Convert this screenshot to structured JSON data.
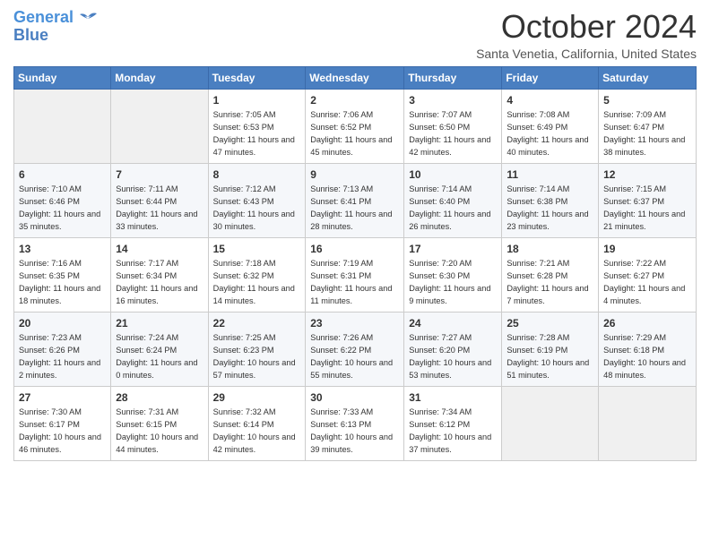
{
  "header": {
    "logo_line1": "General",
    "logo_line2": "Blue",
    "month": "October 2024",
    "location": "Santa Venetia, California, United States"
  },
  "weekdays": [
    "Sunday",
    "Monday",
    "Tuesday",
    "Wednesday",
    "Thursday",
    "Friday",
    "Saturday"
  ],
  "weeks": [
    [
      {
        "day": "",
        "sunrise": "",
        "sunset": "",
        "daylight": ""
      },
      {
        "day": "",
        "sunrise": "",
        "sunset": "",
        "daylight": ""
      },
      {
        "day": "1",
        "sunrise": "Sunrise: 7:05 AM",
        "sunset": "Sunset: 6:53 PM",
        "daylight": "Daylight: 11 hours and 47 minutes."
      },
      {
        "day": "2",
        "sunrise": "Sunrise: 7:06 AM",
        "sunset": "Sunset: 6:52 PM",
        "daylight": "Daylight: 11 hours and 45 minutes."
      },
      {
        "day": "3",
        "sunrise": "Sunrise: 7:07 AM",
        "sunset": "Sunset: 6:50 PM",
        "daylight": "Daylight: 11 hours and 42 minutes."
      },
      {
        "day": "4",
        "sunrise": "Sunrise: 7:08 AM",
        "sunset": "Sunset: 6:49 PM",
        "daylight": "Daylight: 11 hours and 40 minutes."
      },
      {
        "day": "5",
        "sunrise": "Sunrise: 7:09 AM",
        "sunset": "Sunset: 6:47 PM",
        "daylight": "Daylight: 11 hours and 38 minutes."
      }
    ],
    [
      {
        "day": "6",
        "sunrise": "Sunrise: 7:10 AM",
        "sunset": "Sunset: 6:46 PM",
        "daylight": "Daylight: 11 hours and 35 minutes."
      },
      {
        "day": "7",
        "sunrise": "Sunrise: 7:11 AM",
        "sunset": "Sunset: 6:44 PM",
        "daylight": "Daylight: 11 hours and 33 minutes."
      },
      {
        "day": "8",
        "sunrise": "Sunrise: 7:12 AM",
        "sunset": "Sunset: 6:43 PM",
        "daylight": "Daylight: 11 hours and 30 minutes."
      },
      {
        "day": "9",
        "sunrise": "Sunrise: 7:13 AM",
        "sunset": "Sunset: 6:41 PM",
        "daylight": "Daylight: 11 hours and 28 minutes."
      },
      {
        "day": "10",
        "sunrise": "Sunrise: 7:14 AM",
        "sunset": "Sunset: 6:40 PM",
        "daylight": "Daylight: 11 hours and 26 minutes."
      },
      {
        "day": "11",
        "sunrise": "Sunrise: 7:14 AM",
        "sunset": "Sunset: 6:38 PM",
        "daylight": "Daylight: 11 hours and 23 minutes."
      },
      {
        "day": "12",
        "sunrise": "Sunrise: 7:15 AM",
        "sunset": "Sunset: 6:37 PM",
        "daylight": "Daylight: 11 hours and 21 minutes."
      }
    ],
    [
      {
        "day": "13",
        "sunrise": "Sunrise: 7:16 AM",
        "sunset": "Sunset: 6:35 PM",
        "daylight": "Daylight: 11 hours and 18 minutes."
      },
      {
        "day": "14",
        "sunrise": "Sunrise: 7:17 AM",
        "sunset": "Sunset: 6:34 PM",
        "daylight": "Daylight: 11 hours and 16 minutes."
      },
      {
        "day": "15",
        "sunrise": "Sunrise: 7:18 AM",
        "sunset": "Sunset: 6:32 PM",
        "daylight": "Daylight: 11 hours and 14 minutes."
      },
      {
        "day": "16",
        "sunrise": "Sunrise: 7:19 AM",
        "sunset": "Sunset: 6:31 PM",
        "daylight": "Daylight: 11 hours and 11 minutes."
      },
      {
        "day": "17",
        "sunrise": "Sunrise: 7:20 AM",
        "sunset": "Sunset: 6:30 PM",
        "daylight": "Daylight: 11 hours and 9 minutes."
      },
      {
        "day": "18",
        "sunrise": "Sunrise: 7:21 AM",
        "sunset": "Sunset: 6:28 PM",
        "daylight": "Daylight: 11 hours and 7 minutes."
      },
      {
        "day": "19",
        "sunrise": "Sunrise: 7:22 AM",
        "sunset": "Sunset: 6:27 PM",
        "daylight": "Daylight: 11 hours and 4 minutes."
      }
    ],
    [
      {
        "day": "20",
        "sunrise": "Sunrise: 7:23 AM",
        "sunset": "Sunset: 6:26 PM",
        "daylight": "Daylight: 11 hours and 2 minutes."
      },
      {
        "day": "21",
        "sunrise": "Sunrise: 7:24 AM",
        "sunset": "Sunset: 6:24 PM",
        "daylight": "Daylight: 11 hours and 0 minutes."
      },
      {
        "day": "22",
        "sunrise": "Sunrise: 7:25 AM",
        "sunset": "Sunset: 6:23 PM",
        "daylight": "Daylight: 10 hours and 57 minutes."
      },
      {
        "day": "23",
        "sunrise": "Sunrise: 7:26 AM",
        "sunset": "Sunset: 6:22 PM",
        "daylight": "Daylight: 10 hours and 55 minutes."
      },
      {
        "day": "24",
        "sunrise": "Sunrise: 7:27 AM",
        "sunset": "Sunset: 6:20 PM",
        "daylight": "Daylight: 10 hours and 53 minutes."
      },
      {
        "day": "25",
        "sunrise": "Sunrise: 7:28 AM",
        "sunset": "Sunset: 6:19 PM",
        "daylight": "Daylight: 10 hours and 51 minutes."
      },
      {
        "day": "26",
        "sunrise": "Sunrise: 7:29 AM",
        "sunset": "Sunset: 6:18 PM",
        "daylight": "Daylight: 10 hours and 48 minutes."
      }
    ],
    [
      {
        "day": "27",
        "sunrise": "Sunrise: 7:30 AM",
        "sunset": "Sunset: 6:17 PM",
        "daylight": "Daylight: 10 hours and 46 minutes."
      },
      {
        "day": "28",
        "sunrise": "Sunrise: 7:31 AM",
        "sunset": "Sunset: 6:15 PM",
        "daylight": "Daylight: 10 hours and 44 minutes."
      },
      {
        "day": "29",
        "sunrise": "Sunrise: 7:32 AM",
        "sunset": "Sunset: 6:14 PM",
        "daylight": "Daylight: 10 hours and 42 minutes."
      },
      {
        "day": "30",
        "sunrise": "Sunrise: 7:33 AM",
        "sunset": "Sunset: 6:13 PM",
        "daylight": "Daylight: 10 hours and 39 minutes."
      },
      {
        "day": "31",
        "sunrise": "Sunrise: 7:34 AM",
        "sunset": "Sunset: 6:12 PM",
        "daylight": "Daylight: 10 hours and 37 minutes."
      },
      {
        "day": "",
        "sunrise": "",
        "sunset": "",
        "daylight": ""
      },
      {
        "day": "",
        "sunrise": "",
        "sunset": "",
        "daylight": ""
      }
    ]
  ]
}
